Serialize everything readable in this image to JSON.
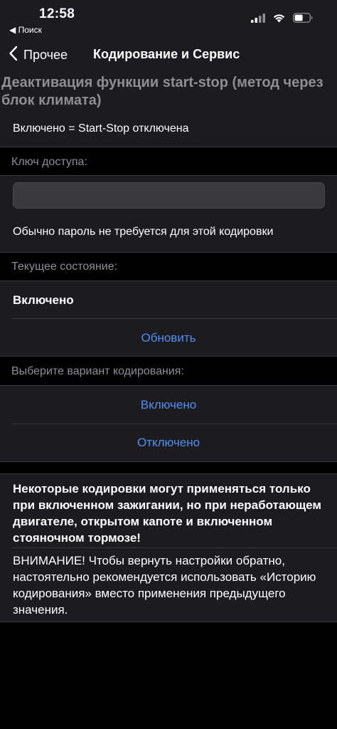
{
  "status_bar": {
    "time": "12:58",
    "back_app": "◀ Поиск"
  },
  "nav": {
    "back_label": "Прочее",
    "title": "Кодирование и Сервис"
  },
  "section_title": "Деактивация функции start-stop (метод через блок климата)",
  "description_row": "Включено = Start-Stop отключена",
  "access_key": {
    "header": "Ключ доступа:",
    "value": "",
    "placeholder": "",
    "note": "Обычно пароль не требуется для этой кодировки"
  },
  "current_state": {
    "header": "Текущее состояние:",
    "value": "Включено",
    "refresh_label": "Обновить"
  },
  "coding_options": {
    "header": "Выберите вариант кодирования:",
    "options": [
      "Включено",
      "Отключено"
    ]
  },
  "warnings": {
    "bold": "Некоторые кодировки могут применяться только при включенном зажигании, но при неработающем двигателе, открытом капоте и включенном стояночном тормозе!",
    "normal": "ВНИМАНИЕ! Чтобы вернуть настройки обратно, настоятельно рекомендуется использовать «Историю кодирования» вместо применения предыдущего значения."
  },
  "colors": {
    "background": "#000000",
    "cell": "#1c1c1e",
    "accent": "#4f8ef7",
    "secondary_text": "#8e8e93"
  },
  "icons": [
    "signal-icon",
    "wifi-icon",
    "battery-icon",
    "chevron-left-icon"
  ]
}
